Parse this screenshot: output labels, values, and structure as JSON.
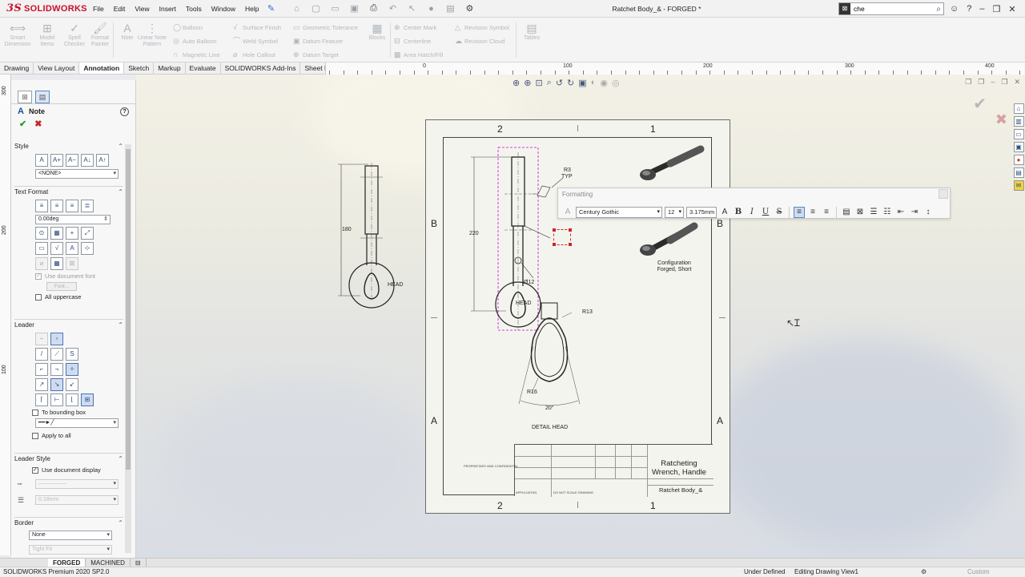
{
  "app": {
    "brand": "SOLIDWORKS",
    "brand_mark": "3S",
    "doc_title": "Ratchet Body_& - FORGED *",
    "menu": [
      "File",
      "Edit",
      "View",
      "Insert",
      "Tools",
      "Window",
      "Help"
    ],
    "search_value": "che"
  },
  "cmd": {
    "smart_dimension": "Smart Dimension",
    "model_items": "Model Items",
    "spell_checker": "Spell Checker",
    "format_painter": "Format Painter",
    "note": "Note",
    "linear_note_pattern": "Linear Note Pattern",
    "balloon": "Balloon",
    "auto_balloon": "Auto Balloon",
    "magnetic_line": "Magnetic Line",
    "surface_finish": "Surface Finish",
    "weld_symbol": "Weld Symbol",
    "hole_callout": "Hole Callout",
    "geometric_tolerance": "Geometric Tolerance",
    "datum_feature": "Datum Feature",
    "datum_target": "Datum Target",
    "blocks": "Blocks",
    "center_mark": "Center Mark",
    "centerline": "Centerline",
    "area_hatch": "Area Hatch/Fill",
    "revision_symbol": "Revision Symbol",
    "revision_cloud": "Revision Cloud",
    "tables": "Tables"
  },
  "tabs": [
    "Drawing",
    "View Layout",
    "Annotation",
    "Sketch",
    "Markup",
    "Evaluate",
    "SOLIDWORKS Add-Ins",
    "Sheet Format"
  ],
  "active_tab_index": 2,
  "ruler_top": [
    "0",
    "100",
    "200",
    "300",
    "400"
  ],
  "ruler_left": [
    "300",
    "200",
    "100"
  ],
  "pm": {
    "title": "Note",
    "style": {
      "title": "Style",
      "value": "<NONE>"
    },
    "text_format": {
      "title": "Text Format",
      "angle": "0.00deg",
      "use_doc_font": "Use document font",
      "font_button": "Font...",
      "all_uppercase": "All uppercase"
    },
    "leader": {
      "title": "Leader",
      "to_bounding_box": "To bounding box",
      "apply_to_all": "Apply to all"
    },
    "leader_style": {
      "title": "Leader Style",
      "use_doc_display": "Use document display",
      "line_weight": "0.18mm"
    },
    "border": {
      "title": "Border",
      "style": "None",
      "size": "Tight Fit"
    }
  },
  "sheet": {
    "zones_top": [
      "2",
      "1"
    ],
    "zones_side": [
      "B",
      "A"
    ],
    "zones_bottom": [
      "2",
      "1"
    ],
    "view1": {
      "len": "180",
      "head": "HEAD"
    },
    "view2": {
      "len": "220",
      "r3": "R3",
      "typ": "TYP",
      "dia": "Ø12",
      "head": "HEAD"
    },
    "detail": {
      "r13": "R13",
      "r16": "R16",
      "angle": "20°",
      "label": "DETAIL HEAD"
    },
    "iso_config": "Configuration Forged, Short",
    "title_block": {
      "title": "Ratcheting Wrench, Handle",
      "dwg_no": "Ratchet Body_&",
      "left_note": "PROPRIETARY AND CONFIDENTIAL",
      "application": "APPLICATION",
      "do_not_scale": "DO NOT SCALE DRAWING"
    }
  },
  "formatting": {
    "title": "Formatting",
    "font": "Century Gothic",
    "size": "12",
    "height": "3.175mm"
  },
  "sheet_tabs": [
    "FORGED",
    "MACHINED"
  ],
  "status": {
    "product": "SOLIDWORKS Premium 2020 SP2.0",
    "state": "Under Defined",
    "editing": "Editing Drawing View1",
    "units": "Custom"
  }
}
